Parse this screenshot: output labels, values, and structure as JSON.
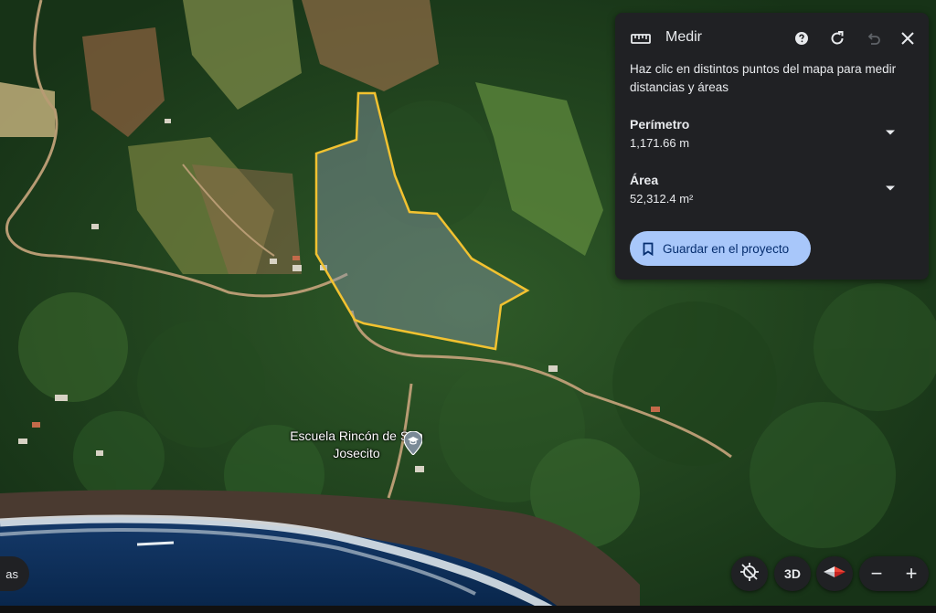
{
  "map": {
    "type": "satellite",
    "poi_label": "Escuela Rincón de San Josecito",
    "poi_icon": "school-pin-icon",
    "measure_outline_color": "#f2c230"
  },
  "measure_panel": {
    "title": "Medir",
    "description": "Haz clic en distintos puntos del mapa para medir distancias y áreas",
    "perimeter_label": "Perímetro",
    "perimeter_value": "1,171.66 m",
    "area_label": "Área",
    "area_value": "52,312.4 m²",
    "save_label": "Guardar en el proyecto",
    "icons": [
      "ruler-icon",
      "help-icon",
      "redo-icon",
      "undo-icon",
      "close-icon",
      "bookmark-icon",
      "chevron-down-icon"
    ]
  },
  "controls": {
    "layers_label": "as",
    "btn_3d": "3D",
    "zoom_out": "−",
    "zoom_in": "+"
  },
  "colors": {
    "panel_bg": "#202124",
    "accent": "#a8c7fa",
    "accent_text": "#062e6f"
  }
}
